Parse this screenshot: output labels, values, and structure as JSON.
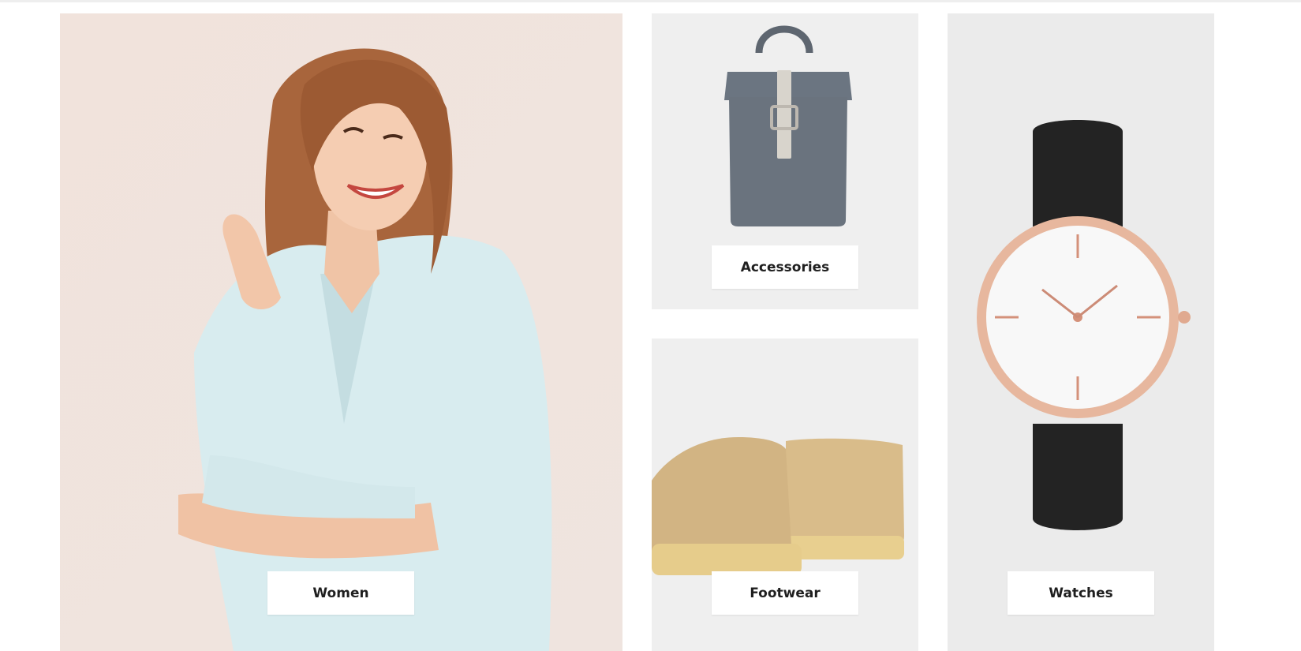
{
  "categories": [
    {
      "key": "women",
      "label": "Women",
      "image": "woman-in-shirt-photo"
    },
    {
      "key": "accessories",
      "label": "Accessories",
      "image": "backpack-photo"
    },
    {
      "key": "footwear",
      "label": "Footwear",
      "image": "suede-shoes-photo"
    },
    {
      "key": "watches",
      "label": "Watches",
      "image": "wristwatch-photo"
    }
  ]
}
